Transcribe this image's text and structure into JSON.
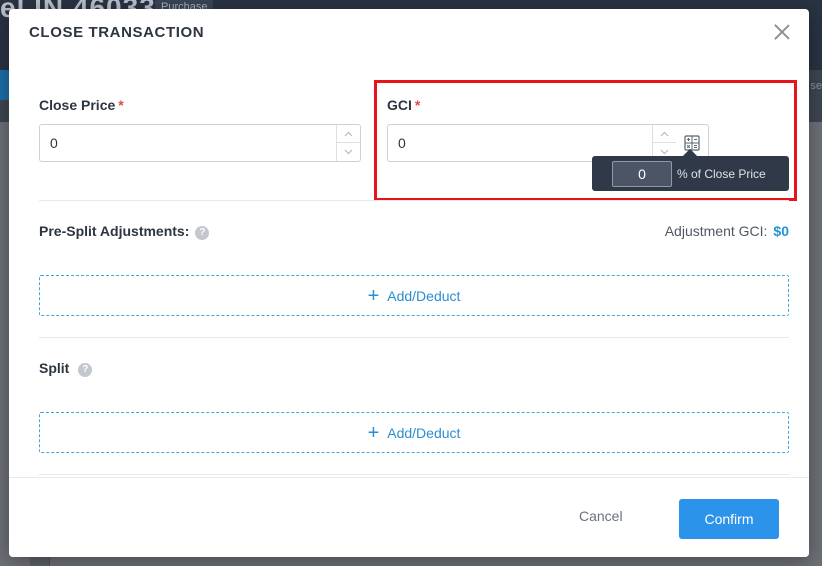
{
  "background": {
    "title": "el IN 46033",
    "badge": "Purchase",
    "strip_text": "se"
  },
  "modal": {
    "title": "CLOSE TRANSACTION",
    "close_icon": "close-icon"
  },
  "close_price": {
    "label": "Close Price",
    "required_mark": "*",
    "value": "0"
  },
  "gci": {
    "label": "GCI",
    "required_mark": "*",
    "value": "0",
    "calc_icon": "calculator-icon",
    "popover": {
      "percent_value": "0",
      "percent_label": "% of Close Price"
    }
  },
  "pre_split": {
    "label": "Pre-Split Adjustments:",
    "help": "?",
    "adjustment_gci_label": "Adjustment GCI:",
    "adjustment_gci_value": "$0",
    "add_button": "Add/Deduct",
    "add_icon": "+"
  },
  "split": {
    "label": "Split",
    "help": "?",
    "add_button": "Add/Deduct",
    "add_icon": "+"
  },
  "footer": {
    "cancel": "Cancel",
    "confirm": "Confirm"
  },
  "colors": {
    "accent": "#2b94ea",
    "link": "#2196d8",
    "required": "#e04848",
    "highlight": "#e8141c",
    "popover": "#303948"
  }
}
